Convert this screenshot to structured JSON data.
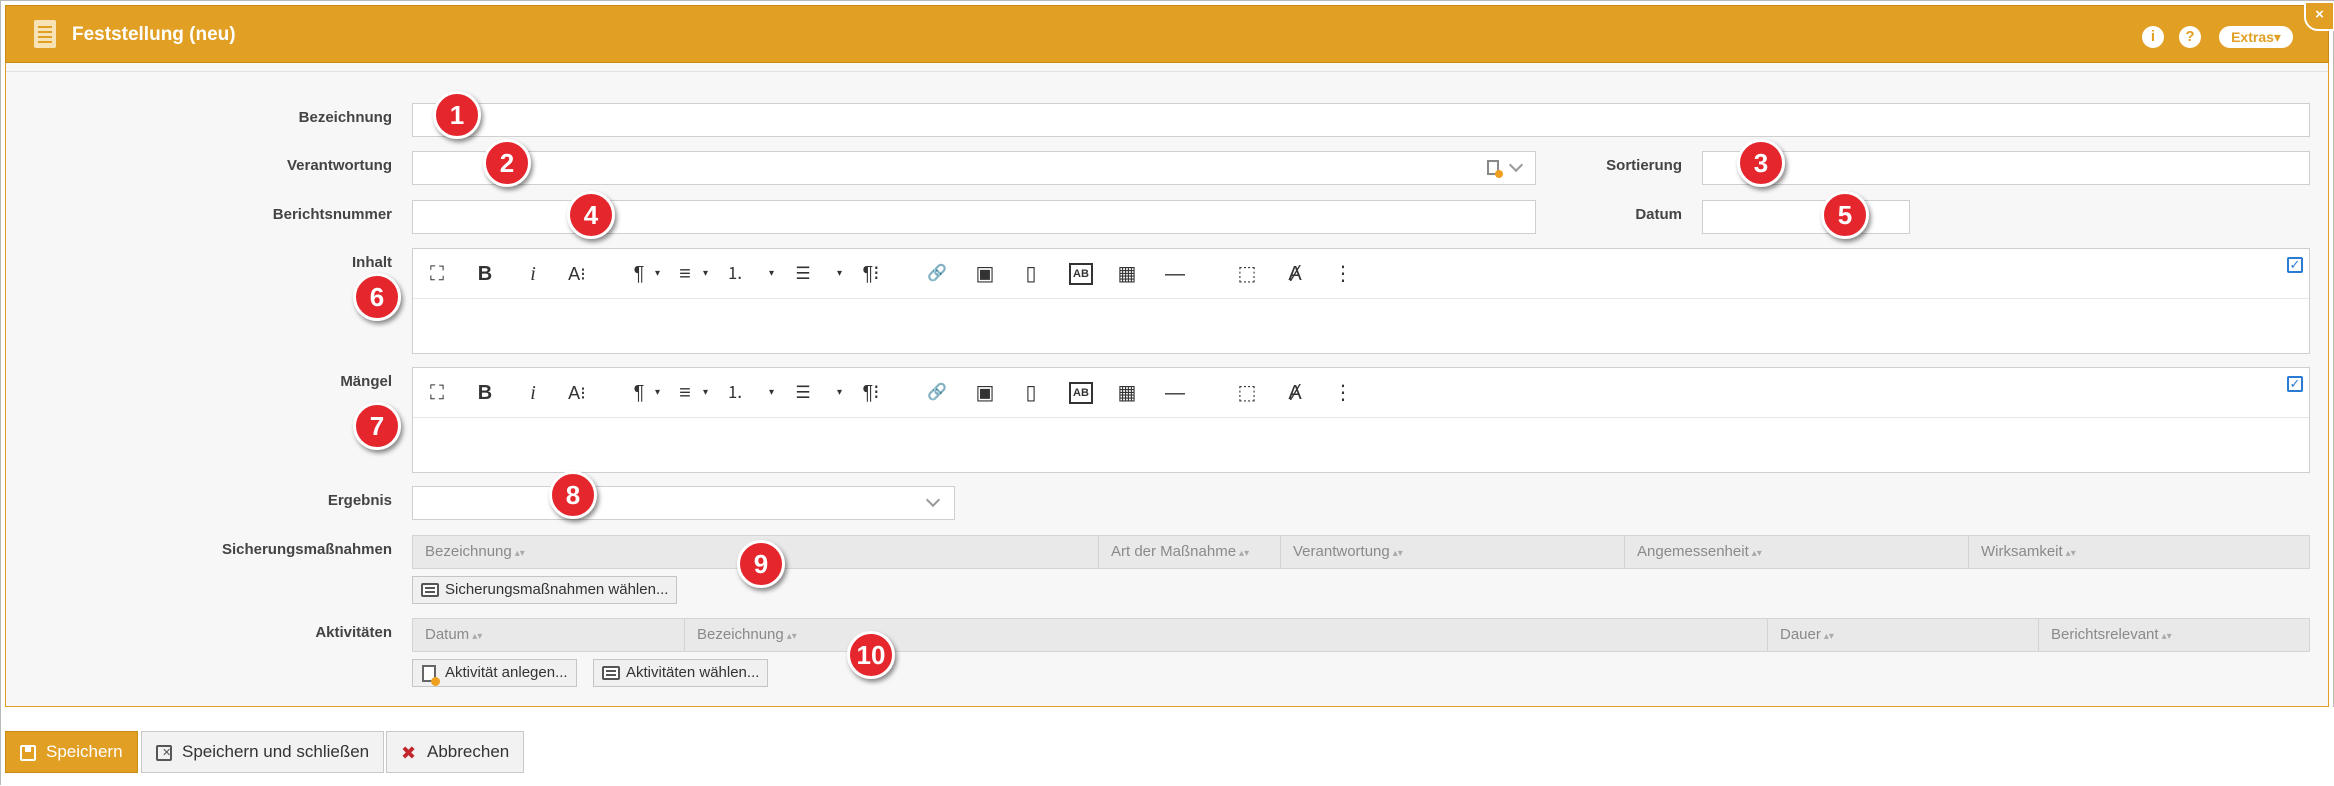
{
  "header": {
    "title": "Feststellung (neu)",
    "info_glyph": "i",
    "help_glyph": "?",
    "extras_label": "Extras",
    "extras_caret": "▾",
    "close_glyph": "×",
    "icons": [
      "document-icon",
      "info-icon",
      "help-icon",
      "close-icon"
    ]
  },
  "form": {
    "bezeichnung_label": "Bezeichnung",
    "bezeichnung_value": "",
    "verantwortung_label": "Verantwortung",
    "verantwortung_value": "",
    "sortierung_label": "Sortierung",
    "sortierung_value": "",
    "berichtsnummer_label": "Berichtsnummer",
    "berichtsnummer_value": "",
    "datum_label": "Datum",
    "datum_value": "",
    "inhalt_label": "Inhalt",
    "maengel_label": "Mängel",
    "ergebnis_label": "Ergebnis",
    "ergebnis_value": "",
    "sicherung_label": "Sicherungsmaßnahmen",
    "aktivitaeten_label": "Aktivitäten"
  },
  "editor_toolbar": {
    "fullscreen": "⛶",
    "bold": "B",
    "italic": "i",
    "font_size": "A⁝",
    "paragraph": "¶",
    "align": "≡",
    "ordered_list": "⒈",
    "unordered_list": "☰",
    "paragraph_style": "¶⁝",
    "link": "🔗",
    "image": "▣",
    "file": "▯",
    "special": "AB",
    "table": "▦",
    "hr": "—",
    "select_all": "⬚",
    "clear_format": "Ⱥ",
    "more": "⋮",
    "caret": "▾",
    "check": "✓"
  },
  "sicherung_table": {
    "columns": [
      "Bezeichnung",
      "Art der Maßnahme",
      "Verantwortung",
      "Angemessenheit",
      "Wirksamkeit"
    ],
    "sort_glyph": "▴▾",
    "choose_button": "Sicherungsmaßnahmen wählen..."
  },
  "aktivitaeten_table": {
    "columns": [
      "Datum",
      "Bezeichnung",
      "Dauer",
      "Berichtsrelevant"
    ],
    "sort_glyph": "▴▾",
    "create_button": "Aktivität anlegen...",
    "choose_button": "Aktivitäten wählen..."
  },
  "markers": [
    "1",
    "2",
    "3",
    "4",
    "5",
    "6",
    "7",
    "8",
    "9",
    "10"
  ],
  "footer": {
    "save": "Speichern",
    "save_close": "Speichern und schließen",
    "cancel": "Abbrechen",
    "cancel_glyph": "✖"
  },
  "colors": {
    "accent": "#e19f23",
    "marker": "#e5262d",
    "checkbox": "#2a7bd3"
  }
}
